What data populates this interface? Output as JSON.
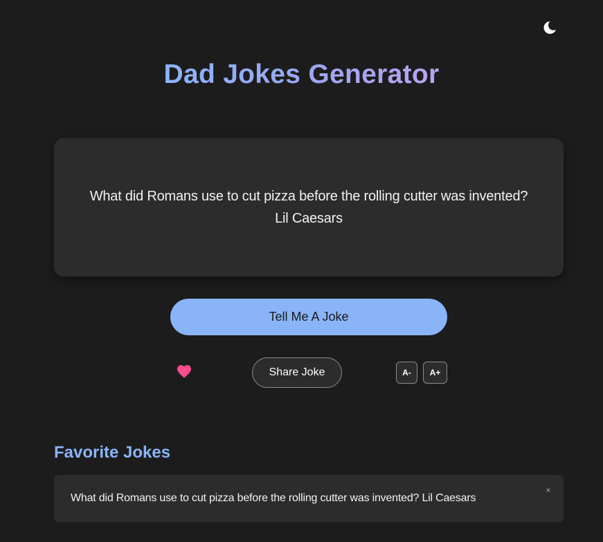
{
  "app": {
    "title": "Dad Jokes Generator",
    "theme_toggle_icon": "moon-icon"
  },
  "joke": {
    "question": "What did Romans use to cut pizza before the rolling cutter was invented?",
    "answer": "Lil Caesars"
  },
  "actions": {
    "tell_joke_label": "Tell Me A Joke",
    "favorite_icon": "heart-icon",
    "share_label": "Share Joke",
    "font_decrease_label": "A-",
    "font_increase_label": "A+"
  },
  "favorites": {
    "heading": "Favorite Jokes",
    "items": [
      {
        "text": "What did Romans use to cut pizza before the rolling cutter was invented? Lil Caesars",
        "remove_label": "×"
      }
    ]
  },
  "colors": {
    "background": "#1c1c1c",
    "card": "#2c2c2c",
    "accent": "#8ab4f8",
    "heart": "#ff4d8d"
  }
}
